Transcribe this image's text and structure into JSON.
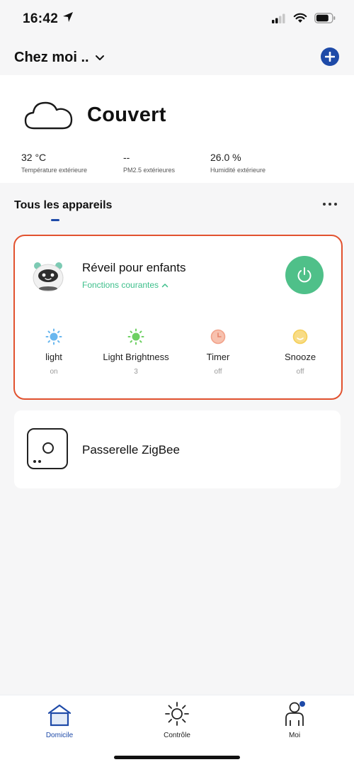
{
  "status_bar": {
    "time": "16:42"
  },
  "header": {
    "home_name": "Chez moi .."
  },
  "weather": {
    "condition": "Couvert",
    "stats": [
      {
        "value": "32 °C",
        "label": "Température extérieure"
      },
      {
        "value": "--",
        "label": "PM2.5 extérieures"
      },
      {
        "value": "26.0 %",
        "label": "Humidité extérieure"
      }
    ]
  },
  "devices_section": {
    "title": "Tous les appareils"
  },
  "device_main": {
    "name": "Réveil pour enfants",
    "functions_link": "Fonctions courantes",
    "power_on": true,
    "functions": [
      {
        "name": "light",
        "state": "on",
        "icon": "sun-icon",
        "color": "#69b7ef"
      },
      {
        "name": "Light Brightness",
        "state": "3",
        "icon": "sun-icon",
        "color": "#6ed063"
      },
      {
        "name": "Timer",
        "state": "off",
        "icon": "clock-icon",
        "color": "#f2a28a"
      },
      {
        "name": "Snooze",
        "state": "off",
        "icon": "smile-icon",
        "color": "#f5cf58"
      }
    ]
  },
  "device_zigbee": {
    "name": "Passerelle ZigBee"
  },
  "tabbar": {
    "tabs": [
      {
        "label": "Domicile",
        "icon": "home-icon",
        "active": true
      },
      {
        "label": "Contrôle",
        "icon": "sun-icon",
        "active": false
      },
      {
        "label": "Moi",
        "icon": "person-icon",
        "active": false
      }
    ]
  },
  "colors": {
    "accent": "#1e4aa8",
    "success": "#4fc089",
    "highlight": "#e2522f"
  }
}
